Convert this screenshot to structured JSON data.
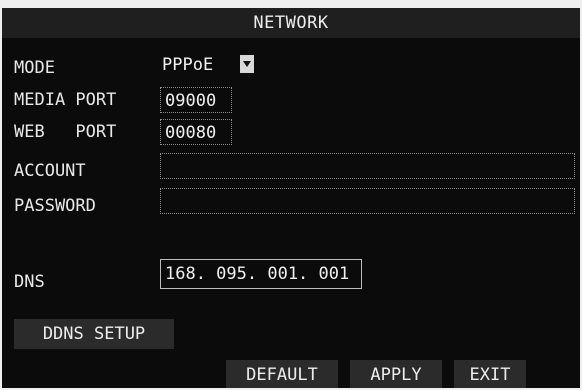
{
  "title": "NETWORK",
  "labels": {
    "mode": "MODE",
    "media_port": "MEDIA PORT",
    "web_port": "WEB   PORT",
    "account": "ACCOUNT",
    "password": "PASSWORD",
    "dns": "DNS"
  },
  "fields": {
    "mode_value": "PPPoE",
    "media_port_value": "09000",
    "web_port_value": "00080",
    "account_value": "",
    "password_value": "",
    "dns_value": "168. 095. 001. 001"
  },
  "buttons": {
    "ddns_setup": "DDNS SETUP",
    "default": "DEFAULT",
    "apply": "APPLY",
    "exit": "EXIT"
  },
  "icons": {
    "mode_dropdown": "chevron-down-icon"
  },
  "colors": {
    "background": "#0b0b0b",
    "title_bar": "#1f1f1f",
    "button": "#2b2b2b",
    "text": "#ececec"
  }
}
